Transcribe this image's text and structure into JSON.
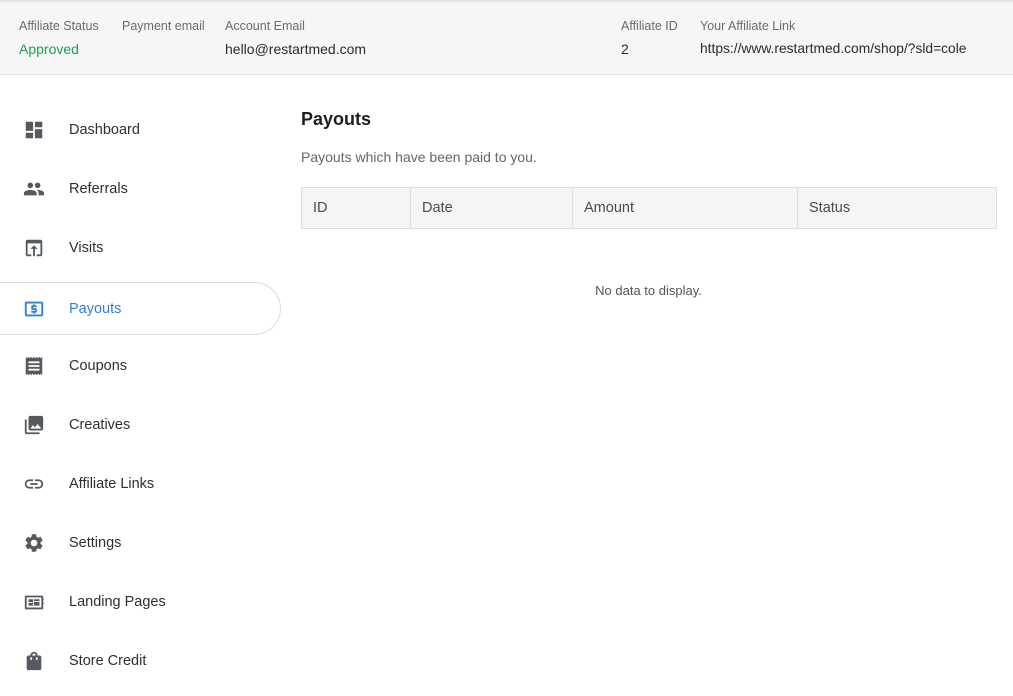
{
  "header": {
    "affiliate_status": {
      "label": "Affiliate Status",
      "value": "Approved"
    },
    "payment_email": {
      "label": "Payment email",
      "value": ""
    },
    "account_email": {
      "label": "Account Email",
      "value": "hello@restartmed.com"
    },
    "affiliate_id": {
      "label": "Affiliate ID",
      "value": "2"
    },
    "affiliate_link": {
      "label": "Your Affiliate Link",
      "value": "https://www.restartmed.com/shop/?sld=cole"
    }
  },
  "sidebar": {
    "items": [
      {
        "label": "Dashboard",
        "icon": "dashboard-icon"
      },
      {
        "label": "Referrals",
        "icon": "people-icon"
      },
      {
        "label": "Visits",
        "icon": "visits-icon"
      },
      {
        "label": "Payouts",
        "icon": "dollar-icon",
        "active": true
      },
      {
        "label": "Coupons",
        "icon": "receipt-icon"
      },
      {
        "label": "Creatives",
        "icon": "images-icon"
      },
      {
        "label": "Affiliate Links",
        "icon": "link-icon"
      },
      {
        "label": "Settings",
        "icon": "gear-icon"
      },
      {
        "label": "Landing Pages",
        "icon": "landing-pages-icon"
      },
      {
        "label": "Store Credit",
        "icon": "shopping-bag-icon"
      }
    ]
  },
  "main": {
    "title": "Payouts",
    "description": "Payouts which have been paid to you.",
    "table": {
      "columns": [
        "ID",
        "Date",
        "Amount",
        "Status"
      ],
      "rows": [],
      "empty_text": "No data to display."
    }
  },
  "colors": {
    "accent": "#2f7fd9",
    "status_ok": "#1f9d4c",
    "header_bg": "#f6f6f6"
  }
}
